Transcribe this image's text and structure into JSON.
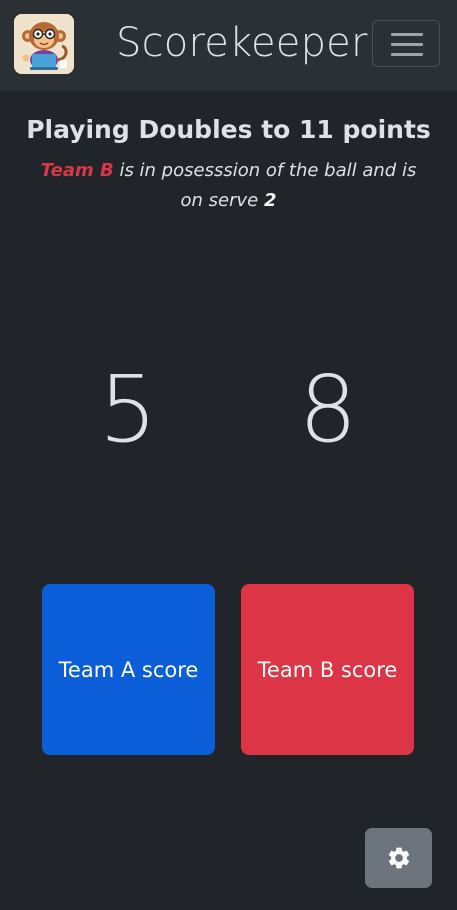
{
  "app": {
    "brand": "Scorekeeper",
    "logo_icon": "monkey-mascot-icon",
    "menu_icon": "hamburger-menu-icon"
  },
  "game": {
    "heading": "Playing Doubles to 11 points",
    "status": {
      "team": "Team B",
      "middle": " is in posesssion of the ball and is on serve ",
      "serve": "2"
    }
  },
  "scores": {
    "team_a": "5",
    "team_b": "8"
  },
  "buttons": {
    "team_a_label": "Team A score",
    "team_b_label": "Team B score",
    "settings_icon": "gear-icon"
  },
  "colors": {
    "team_a": "#0b5ed7",
    "team_b": "#dc3545",
    "background": "#212529",
    "navbar": "#2b3035",
    "settings": "#6c757d"
  }
}
